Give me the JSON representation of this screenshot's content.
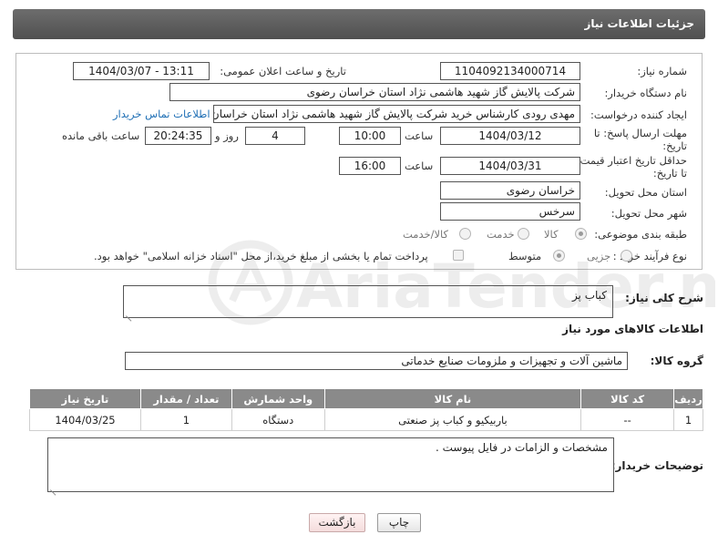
{
  "header": {
    "title": "جزئیات اطلاعات نیاز"
  },
  "fields": {
    "need_number": {
      "label": "شماره نیاز:",
      "value": "1104092134000714"
    },
    "announce_datetime": {
      "label": "تاریخ و ساعت اعلان عمومی:",
      "value": "1404/03/07 - 13:11"
    },
    "buyer_org": {
      "label": "نام دستگاه خریدار:",
      "value": "شرکت پالایش گاز شهید هاشمی نژاد   استان خراسان رضوی"
    },
    "requester": {
      "label": "ایجاد کننده درخواست:",
      "value": "مهدی رودی کارشناس خرید شرکت پالایش گاز شهید هاشمی نژاد   استان خراسان رضوی",
      "link": "اطلاعات تماس خریدار"
    },
    "response_deadline": {
      "label_line1": "مهلت ارسال پاسخ: تا",
      "label_line2": "تاریخ:",
      "date": "1404/03/12",
      "time_label": "ساعت",
      "time": "10:00",
      "days": "4",
      "days_label": "روز و",
      "remaining_time": "20:24:35",
      "remaining_label": "ساعت باقی مانده"
    },
    "price_validity": {
      "label_line1": "حداقل تاریخ اعتبار قیمت:",
      "label_line2": "تا تاریخ:",
      "date": "1404/03/31",
      "time_label": "ساعت",
      "time": "16:00"
    },
    "delivery_province": {
      "label": "استان محل تحویل:",
      "value": "خراسان رضوی"
    },
    "delivery_city": {
      "label": "شهر محل تحویل:",
      "value": "سرخس"
    },
    "category": {
      "label": "طبقه بندی موضوعی:",
      "options": [
        "کالا",
        "خدمت",
        "کالا/خدمت"
      ],
      "selected": "کالا"
    },
    "process_type": {
      "label": "نوع فرآیند خرید :",
      "options": [
        "جزیی",
        "متوسط"
      ],
      "selected": "متوسط",
      "note": "پرداخت تمام یا بخشی از مبلغ خرید،از محل \"اسناد خزانه اسلامی\" خواهد بود."
    }
  },
  "general_description": {
    "label": "شرح کلی نیاز:",
    "value": "کباب پز"
  },
  "goods_section": {
    "title": "اطلاعات کالاهای مورد نیاز",
    "group_label": "گروه کالا:",
    "group_value": "ماشین آلات و تجهیزات و ملزومات صنایع خدماتی"
  },
  "table": {
    "columns": [
      "ردیف",
      "کد کالا",
      "نام کالا",
      "واحد شمارش",
      "تعداد / مقدار",
      "تاریخ نیاز"
    ],
    "rows": [
      [
        "1",
        "--",
        "باربیکیو و کباب پز صنعتی",
        "دستگاه",
        "1",
        "1404/03/25"
      ]
    ]
  },
  "buyer_notes": {
    "label": "توضیحات خریدار:",
    "value": "مشخصات و الزامات در فایل پیوست ."
  },
  "buttons": {
    "print": "چاپ",
    "back": "بازگشت"
  },
  "watermark": {
    "text": "AriaTender.neT"
  }
}
